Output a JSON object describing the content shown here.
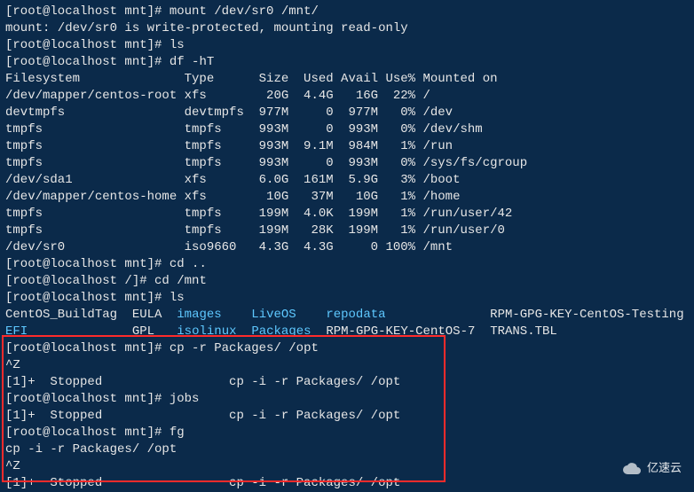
{
  "prompt": {
    "root_mnt": "[root@localhost mnt]# ",
    "root_slash": "[root@localhost /]# "
  },
  "cmd": {
    "mount": "mount /dev/sr0 /mnt/",
    "mount_reply": "mount: /dev/sr0 is write-protected, mounting read-only",
    "ls1": "ls",
    "dfht": "df -hT",
    "cdup": "cd ..",
    "cdmnt": "cd /mnt",
    "ls2": "ls",
    "cp": "cp -r Packages/ /opt",
    "ctrlz1": "^Z",
    "job_stopped1": "[1]+  Stopped                 cp -i -r Packages/ /opt",
    "jobs": "jobs",
    "job_stopped2": "[1]+  Stopped                 cp -i -r Packages/ /opt",
    "fg": "fg",
    "fg_line": "cp -i -r Packages/ /opt",
    "ctrlz2": "^Z",
    "job_stopped3": "[1]+  Stopped                 cp -i -r Packages/ /opt"
  },
  "df": {
    "header": "Filesystem              Type      Size  Used Avail Use% Mounted on",
    "rows": [
      "/dev/mapper/centos-root xfs        20G  4.4G   16G  22% /",
      "devtmpfs                devtmpfs  977M     0  977M   0% /dev",
      "tmpfs                   tmpfs     993M     0  993M   0% /dev/shm",
      "tmpfs                   tmpfs     993M  9.1M  984M   1% /run",
      "tmpfs                   tmpfs     993M     0  993M   0% /sys/fs/cgroup",
      "/dev/sda1               xfs       6.0G  161M  5.9G   3% /boot",
      "/dev/mapper/centos-home xfs        10G   37M   10G   1% /home",
      "tmpfs                   tmpfs     199M  4.0K  199M   1% /run/user/42",
      "tmpfs                   tmpfs     199M   28K  199M   1% /run/user/0",
      "/dev/sr0                iso9660   4.3G  4.3G     0 100% /mnt"
    ]
  },
  "ls": {
    "row1": {
      "c1": "CentOS_BuildTag",
      "c2": "EULA",
      "c3": "images",
      "c4": "LiveOS",
      "c5": "repodata",
      "c6": "RPM-GPG-KEY-CentOS-Testing"
    },
    "row2": {
      "c1": "EFI",
      "c2": "GPL",
      "c3": "isolinux",
      "c4": "Packages",
      "c5": "RPM-GPG-KEY-CentOS-7",
      "c6": "TRANS.TBL"
    }
  },
  "watermark": "亿速云"
}
